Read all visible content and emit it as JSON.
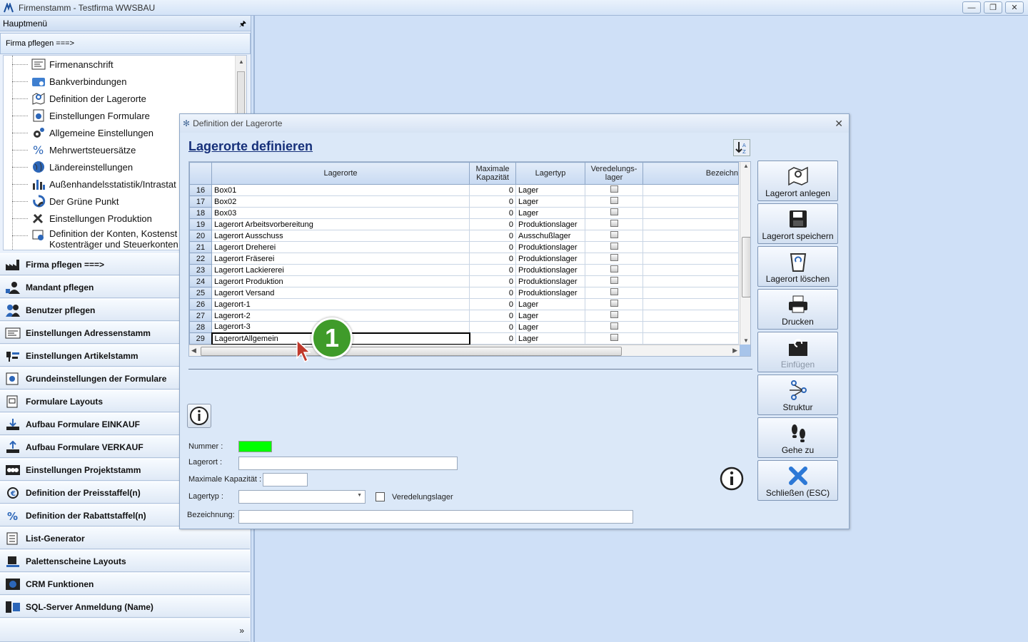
{
  "window": {
    "title": "Firmenstamm - Testfirma WWSBAU"
  },
  "sidebar": {
    "header": "Hauptmenü",
    "subheader": "Firma pflegen   ===>",
    "tree_items": [
      {
        "label": "Firmenanschrift",
        "icon": "address-card-icon"
      },
      {
        "label": "Bankverbindungen",
        "icon": "bank-card-icon"
      },
      {
        "label": "Definition der Lagerorte",
        "icon": "map-pin-icon"
      },
      {
        "label": "Einstellungen Formulare",
        "icon": "form-gear-icon"
      },
      {
        "label": "Allgemeine Einstellungen",
        "icon": "gears-icon"
      },
      {
        "label": "Mehrwertsteuersätze",
        "icon": "percent-icon"
      },
      {
        "label": "Ländereinstellungen",
        "icon": "globe-icon"
      },
      {
        "label": "Außenhandelsstatistik/Intrastat",
        "icon": "bar-chart-icon"
      },
      {
        "label": "Der Grüne Punkt",
        "icon": "recycle-icon"
      },
      {
        "label": "Einstellungen Produktion",
        "icon": "tools-icon"
      },
      {
        "label": "Definition der Konten, Kostenst",
        "label2": "Kostenträger und Steuerkonten",
        "icon": "accounts-icon"
      }
    ],
    "nav": [
      {
        "label": "Firma pflegen   ===>",
        "icon": "factory-icon"
      },
      {
        "label": "Mandant pflegen",
        "icon": "user-icon"
      },
      {
        "label": "Benutzer pflegen",
        "icon": "users-icon"
      },
      {
        "label": "Einstellungen Adressenstamm",
        "icon": "address-icon"
      },
      {
        "label": "Einstellungen Artikelstamm",
        "icon": "article-icon"
      },
      {
        "label": "Grundeinstellungen der Formulare",
        "icon": "form-settings-icon"
      },
      {
        "label": "Formulare Layouts",
        "icon": "layout-icon"
      },
      {
        "label": "Aufbau Formulare EINKAUF",
        "icon": "download-tray-icon"
      },
      {
        "label": "Aufbau Formulare VERKAUF",
        "icon": "upload-tray-icon"
      },
      {
        "label": "Einstellungen Projektstamm",
        "icon": "project-icon"
      },
      {
        "label": "Definition der Preisstaffel(n)",
        "icon": "price-icon"
      },
      {
        "label": "Definition der Rabattstaffel(n)",
        "icon": "discount-icon"
      },
      {
        "label": "List-Generator",
        "icon": "list-icon"
      },
      {
        "label": "Palettenscheine Layouts",
        "icon": "pallet-icon"
      },
      {
        "label": "CRM Funktionen",
        "icon": "crm-icon"
      },
      {
        "label": "SQL-Server Anmeldung (Name)",
        "icon": "server-icon"
      }
    ]
  },
  "dialog": {
    "title": "Definition der Lagerorte",
    "heading": "Lagerorte definieren",
    "columns": {
      "lagerorte": "Lagerorte",
      "kap1": "Maximale",
      "kap2": "Kapazität",
      "typ": "Lagertyp",
      "ved1": "Veredelungs-",
      "ved2": "lager",
      "bez": "Bezeichn"
    },
    "rows": [
      {
        "nr": "16",
        "name": "Box01",
        "kap": "0",
        "typ": "Lager"
      },
      {
        "nr": "17",
        "name": "Box02",
        "kap": "0",
        "typ": "Lager"
      },
      {
        "nr": "18",
        "name": "Box03",
        "kap": "0",
        "typ": "Lager"
      },
      {
        "nr": "19",
        "name": "Lagerort Arbeitsvorbereitung",
        "kap": "0",
        "typ": "Produktionslager"
      },
      {
        "nr": "20",
        "name": "Lagerort Ausschuss",
        "kap": "0",
        "typ": "Ausschußlager"
      },
      {
        "nr": "21",
        "name": "Lagerort Dreherei",
        "kap": "0",
        "typ": "Produktionslager"
      },
      {
        "nr": "22",
        "name": "Lagerort Fräserei",
        "kap": "0",
        "typ": "Produktionslager"
      },
      {
        "nr": "23",
        "name": "Lagerort Lackiererei",
        "kap": "0",
        "typ": "Produktionslager"
      },
      {
        "nr": "24",
        "name": "Lagerort Produktion",
        "kap": "0",
        "typ": "Produktionslager"
      },
      {
        "nr": "25",
        "name": "Lagerort Versand",
        "kap": "0",
        "typ": "Produktionslager"
      },
      {
        "nr": "26",
        "name": "Lagerort-1",
        "kap": "0",
        "typ": "Lager"
      },
      {
        "nr": "27",
        "name": "Lagerort-2",
        "kap": "0",
        "typ": "Lager"
      },
      {
        "nr": "28",
        "name": "Lagerort-3",
        "kap": "0",
        "typ": "Lager"
      },
      {
        "nr": "29",
        "name": "LagerortAllgemein",
        "kap": "0",
        "typ": "Lager"
      }
    ],
    "form": {
      "nummer_label": "Nummer :",
      "lagerort_label": "Lagerort :",
      "kapazitaet_label": "Maximale Kapazität :",
      "lagertyp_label": "Lagertyp :",
      "veredelung_label": "Veredelungslager",
      "bezeichnung_label": "Bezeichnung:",
      "nummer_color": "#00ff00"
    },
    "buttons": [
      {
        "label": "Lagerort anlegen",
        "icon": "map-add-icon",
        "enabled": true
      },
      {
        "label": "Lagerort speichern",
        "icon": "save-icon",
        "enabled": true
      },
      {
        "label": "Lagerort löschen",
        "icon": "trash-icon",
        "enabled": true
      },
      {
        "label": "Drucken",
        "icon": "printer-icon",
        "enabled": true
      },
      {
        "label": "Einfügen",
        "icon": "paste-icon",
        "enabled": false
      },
      {
        "label": "Struktur",
        "icon": "structure-icon",
        "enabled": true
      },
      {
        "label": "Gehe zu",
        "icon": "footprints-icon",
        "enabled": true
      },
      {
        "label": "Schließen (ESC)",
        "icon": "close-x-icon",
        "enabled": true
      }
    ]
  },
  "annotation": {
    "badge": "1",
    "badge_color": "#3f9b2a"
  }
}
